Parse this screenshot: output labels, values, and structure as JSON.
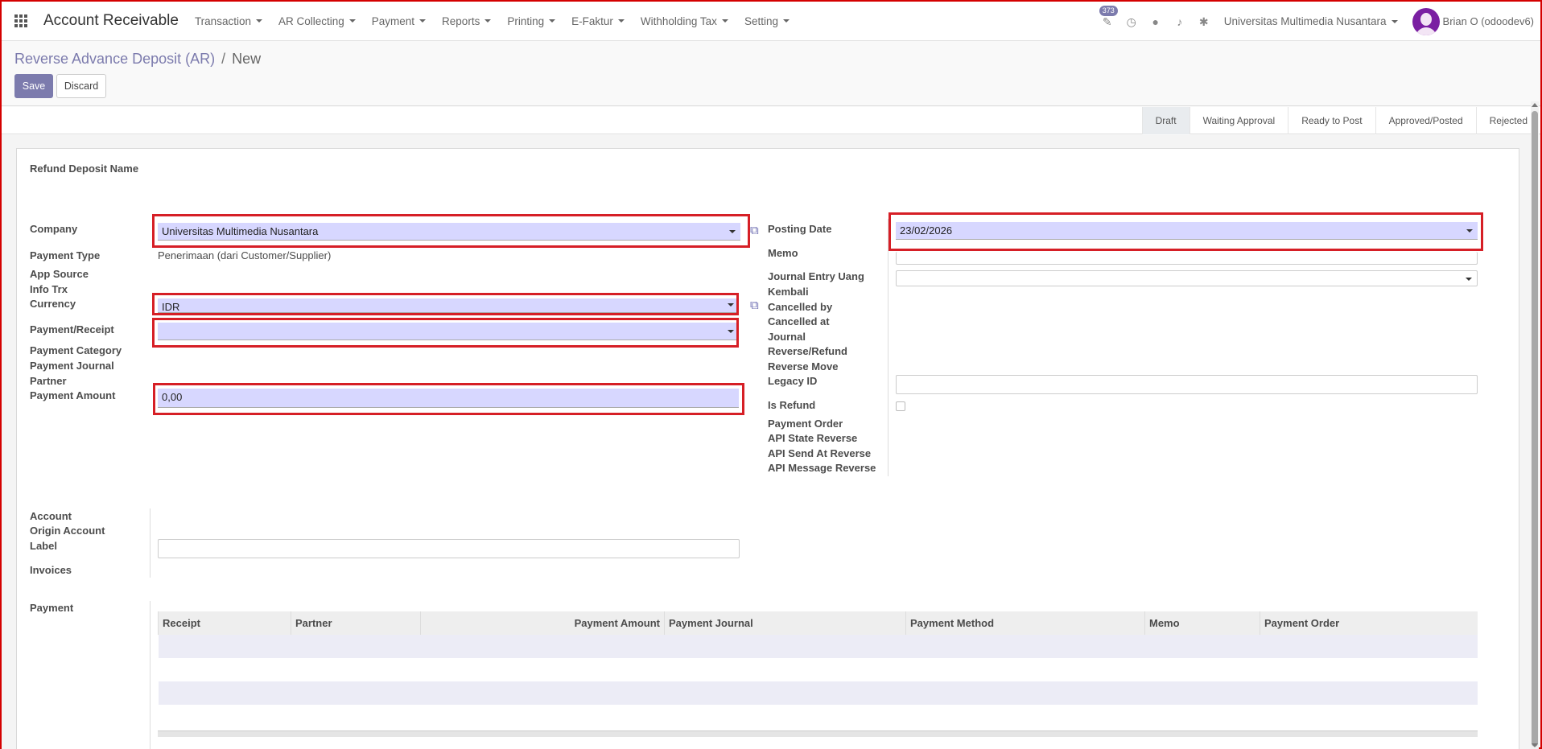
{
  "topbar": {
    "app_name": "Account Receivable",
    "menu": [
      "Transaction",
      "AR Collecting",
      "Payment",
      "Reports",
      "Printing",
      "E-Faktur",
      "Withholding Tax",
      "Setting"
    ],
    "activity_count": "373",
    "company": "Universitas Multimedia Nusantara",
    "user": "Brian O (odoodev6)"
  },
  "control_panel": {
    "breadcrumb_parent": "Reverse Advance Deposit (AR)",
    "breadcrumb_sep": "/",
    "breadcrumb_current": "New",
    "save_label": "Save",
    "discard_label": "Discard"
  },
  "statusbar": {
    "stages": [
      "Draft",
      "Waiting Approval",
      "Ready to Post",
      "Approved/Posted",
      "Rejected"
    ],
    "active_stage": "Draft"
  },
  "form": {
    "title_label": "Refund Deposit Name",
    "left_labels": {
      "company": "Company",
      "payment_type": "Payment Type",
      "app_source": "App Source",
      "info_trx": "Info Trx",
      "currency": "Currency",
      "payment_receipt": "Payment/Receipt",
      "payment_category": "Payment Category",
      "payment_journal": "Payment Journal",
      "partner": "Partner",
      "payment_amount": "Payment Amount"
    },
    "left_values": {
      "company": "Universitas Multimedia Nusantara",
      "payment_type": "Penerimaan (dari Customer/Supplier)",
      "currency": "IDR",
      "payment_receipt": "",
      "payment_amount": "0,00"
    },
    "right_labels": {
      "posting_date": "Posting Date",
      "memo": "Memo",
      "journal_entry_1": "Journal Entry Uang",
      "journal_entry_2": "Kembali",
      "cancelled_by": "Cancelled by",
      "cancelled_at": "Cancelled at",
      "journal_rr_1": "Journal",
      "journal_rr_2": "Reverse/Refund",
      "reverse_move": "Reverse Move",
      "legacy_id": "Legacy ID",
      "is_refund": "Is Refund",
      "payment_order": "Payment Order",
      "api_state": "API State Reverse",
      "api_send_at": "API Send At Reverse",
      "api_message": "API Message Reverse"
    },
    "right_values": {
      "posting_date": "23/02/2026",
      "memo": "",
      "legacy_id": ""
    },
    "account_labels": {
      "account": "Account",
      "origin_account": "Origin Account",
      "label": "Label",
      "invoices": "Invoices"
    },
    "payment_section_label": "Payment",
    "payment_table_headers": [
      "Receipt",
      "Partner",
      "Payment Amount",
      "Payment Journal",
      "Payment Method",
      "Memo",
      "Payment Order"
    ]
  }
}
